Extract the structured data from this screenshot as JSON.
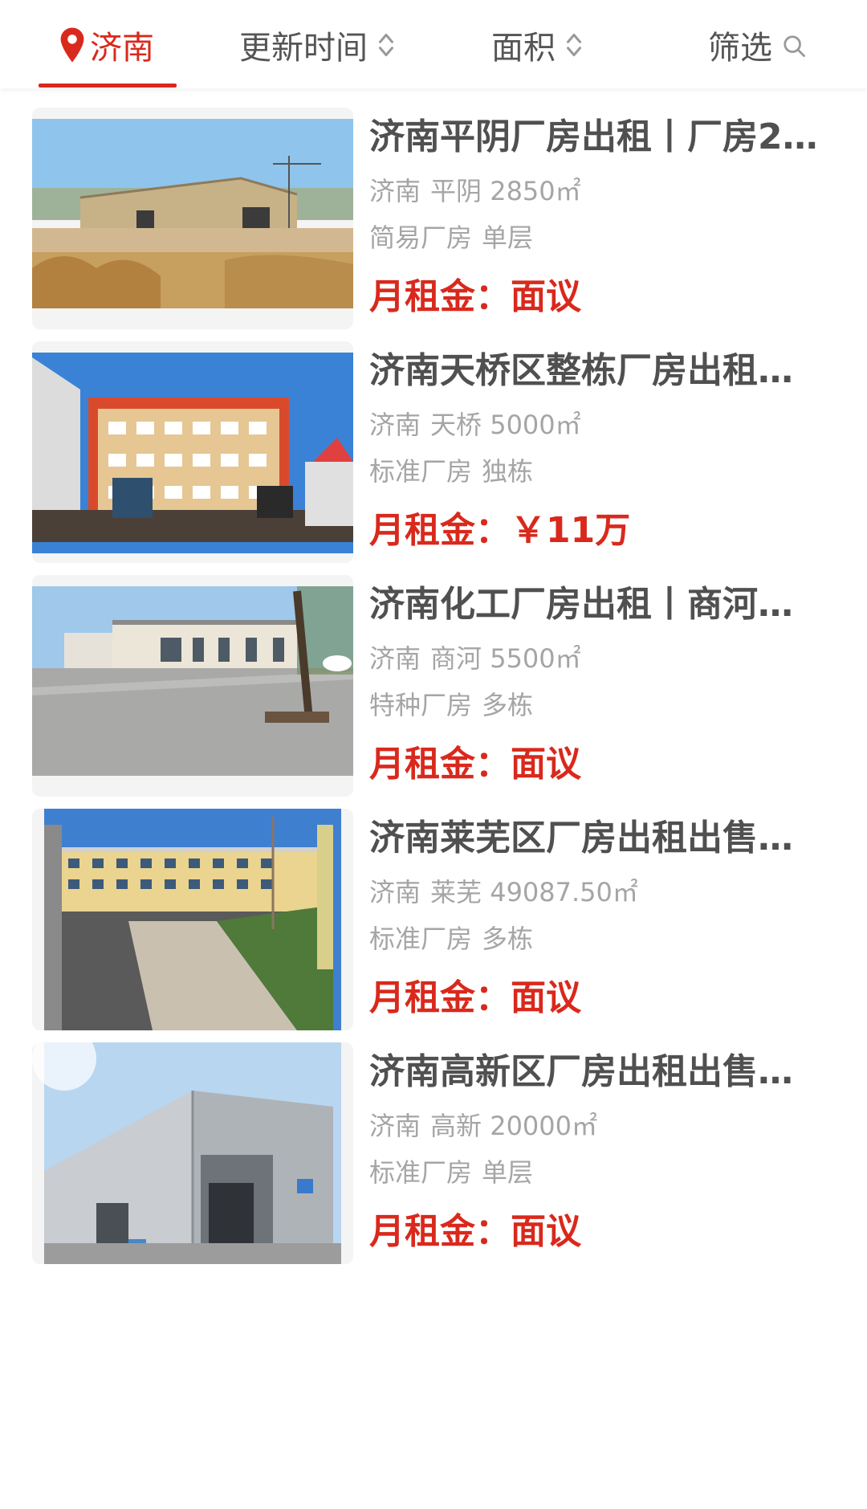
{
  "filters": {
    "city": "济南",
    "time": "更新时间",
    "area": "面积",
    "screen": "筛选"
  },
  "colors": {
    "accent": "#d9291c",
    "text_primary": "#505050",
    "text_secondary": "#a5a5a5"
  },
  "listings": [
    {
      "title": "济南平阴厂房出租丨厂房2…",
      "city": "济南",
      "district": "平阴",
      "area": "2850㎡",
      "type": "简易厂房",
      "floors": "单层",
      "price_label": "月租金：",
      "price_value": "面议"
    },
    {
      "title": "济南天桥区整栋厂房出租…",
      "city": "济南",
      "district": "天桥",
      "area": "5000㎡",
      "type": "标准厂房",
      "floors": "独栋",
      "price_label": "月租金：",
      "price_value": "￥11万"
    },
    {
      "title": "济南化工厂房出租丨商河…",
      "city": "济南",
      "district": "商河",
      "area": "5500㎡",
      "type": "特种厂房",
      "floors": "多栋",
      "price_label": "月租金：",
      "price_value": "面议"
    },
    {
      "title": "济南莱芜区厂房出租出售…",
      "city": "济南",
      "district": "莱芜",
      "area": "49087.50㎡",
      "type": "标准厂房",
      "floors": "多栋",
      "price_label": "月租金：",
      "price_value": "面议"
    },
    {
      "title": "济南高新区厂房出租出售…",
      "city": "济南",
      "district": "高新",
      "area": "20000㎡",
      "type": "标准厂房",
      "floors": "单层",
      "price_label": "月租金：",
      "price_value": "面议"
    }
  ]
}
